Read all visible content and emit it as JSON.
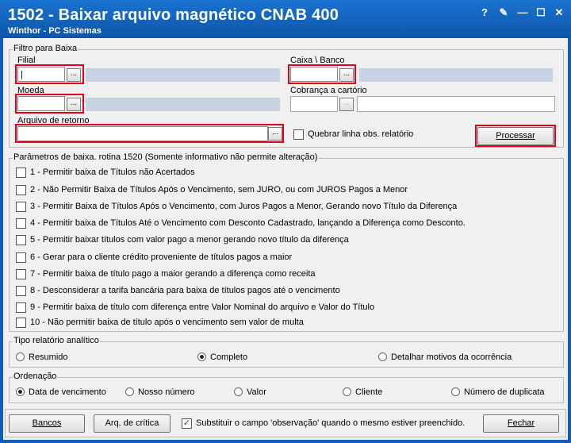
{
  "window": {
    "title": "1502 - Baixar arquivo magnético CNAB 400",
    "subtitle": "Winthor - PC Sistemas",
    "controls": [
      "?",
      "✎",
      "—",
      "☐",
      "✕"
    ]
  },
  "filtro": {
    "group_title": "Filtro para Baixa",
    "filial_label": "Filial",
    "filial_value": "|",
    "caixa_banco_label": "Caixa \\ Banco",
    "moeda_label": "Moeda",
    "cobranca_label": "Cobrança a cartório",
    "arquivo_label": "Arquivo de retorno",
    "dots": "...",
    "quebrar_label": "Quebrar linha obs. relatório",
    "processar_label": "Processar"
  },
  "parametros": {
    "group_title": "Parâmetros de baixa. rotina 1520 (Somente informativo não permite alteração)",
    "items": [
      "1 - Permitir baixa de Títulos não Acertados",
      "2 - Não Permitir Baixa de Títulos Após o Vencimento, sem JURO, ou com JUROS Pagos a Menor",
      "3 - Permitir Baixa de Títulos Após o Vencimento, com Juros Pagos a Menor, Gerando novo Título da Diferença",
      "4 - Permitir baixa de Títulos Até o Vencimento com Desconto Cadastrado, lançando a Diferença como Desconto.",
      "5 - Permitir baixar títulos com valor pago a menor gerando novo título da diferença",
      "6 - Gerar para o cliente crédito proveniente de títulos pagos a maior",
      "7 - Permitir baixa de título pago a maior gerando a diferença como receita",
      "8 - Desconsiderar a tarifa bancária para baixa de títulos pagos até o vencimento",
      "9 - Permitir baixa de título com diferença entre Valor Nominal do arquivo e Valor do Título",
      "10 - Não permitir baixa de título após o vencimento sem valor de multa"
    ]
  },
  "tipo_relatorio": {
    "group_title": "Tipo relatório analítico",
    "options": [
      "Resumido",
      "Completo",
      "Detalhar motivos da ocorrência"
    ],
    "selected": "Completo"
  },
  "ordenacao": {
    "group_title": "Ordenação",
    "options": [
      "Data de vencimento",
      "Nosso número",
      "Valor",
      "Cliente",
      "Número de duplicata"
    ],
    "selected": "Data de vencimento"
  },
  "footer": {
    "bancos_label": "Bancos",
    "arq_critica_label": "Arq. de crítica",
    "substituir_label": "Substituir o campo 'observação' quando o mesmo estiver preenchido.",
    "substituir_checked": true,
    "fechar_label": "Fechar"
  }
}
